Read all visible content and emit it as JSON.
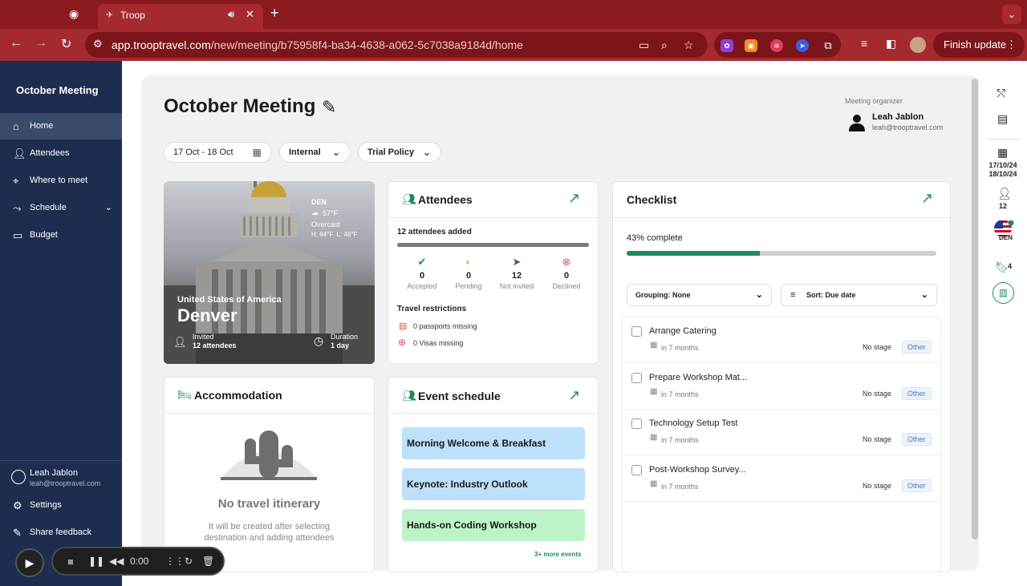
{
  "browser": {
    "tab_title": "Troop",
    "url_host": "app.trooptravel.com",
    "url_path": "/new/meeting/b75958f4-ba34-4638-a062-5c7038a9184d/home",
    "finish_update": "Finish update"
  },
  "sidebar": {
    "title": "October Meeting",
    "items": [
      {
        "label": "Home",
        "icon": "home-icon"
      },
      {
        "label": "Attendees",
        "icon": "people-icon"
      },
      {
        "label": "Where to meet",
        "icon": "pin-icon"
      },
      {
        "label": "Schedule",
        "icon": "route-icon"
      },
      {
        "label": "Budget",
        "icon": "card-icon"
      }
    ],
    "user_name": "Leah Jablon",
    "user_email": "leah@trooptravel.com",
    "settings": "Settings",
    "share_feedback": "Share feedback"
  },
  "header": {
    "title": "October Meeting",
    "organizer_label": "Meeting organizer",
    "organizer_name": "Leah Jablon",
    "organizer_email": "leah@trooptravel.com"
  },
  "filters": {
    "dates": "17 Oct - 18 Oct",
    "type": "Internal",
    "policy": "Trial Policy"
  },
  "destination": {
    "code": "DEN",
    "temp": "57°F",
    "condition": "Overcast",
    "high_low": "H: 64°F  L: 46°F",
    "country": "United States of America",
    "city": "Denver",
    "invited_label": "Invited",
    "invited_value": "12 attendees",
    "duration_label": "Duration",
    "duration_value": "1 day"
  },
  "attendees": {
    "title": "Attendees",
    "added": "12 attendees added",
    "progress": 1.0,
    "stats": [
      {
        "num": "0",
        "label": "Accepted"
      },
      {
        "num": "0",
        "label": "Pending"
      },
      {
        "num": "12",
        "label": "Not invited"
      },
      {
        "num": "0",
        "label": "Declined"
      }
    ],
    "restrictions_title": "Travel restrictions",
    "passports": "0 passports missing",
    "visas": "0 Visas missing"
  },
  "checklist": {
    "title": "Checklist",
    "complete_label": "43% complete",
    "progress": 0.43,
    "grouping": "Grouping: None",
    "sort": "Sort: Due date",
    "tasks": [
      {
        "name": "Arrange Catering",
        "due": "in 7 months",
        "stage": "No stage",
        "category": "Other"
      },
      {
        "name": "Prepare Workshop Mat...",
        "due": "in 7 months",
        "stage": "No stage",
        "category": "Other"
      },
      {
        "name": "Technology Setup Test",
        "due": "in 7 months",
        "stage": "No stage",
        "category": "Other"
      },
      {
        "name": "Post-Workshop Survey...",
        "due": "in 7 months",
        "stage": "No stage",
        "category": "Other"
      }
    ]
  },
  "accommodation": {
    "title": "Accommodation",
    "empty_title": "No travel itinerary",
    "empty_desc_1": "It will be created after selecting",
    "empty_desc_2": "destination and adding attendees"
  },
  "schedule": {
    "title": "Event schedule",
    "events": [
      {
        "name": "Morning Welcome & Breakfast",
        "color": "#bde0fb"
      },
      {
        "name": "Keynote: Industry Outlook",
        "color": "#bde0fb"
      },
      {
        "name": "Hands-on Coding Workshop",
        "color": "#bdf3c8"
      }
    ],
    "more": "3+ more events"
  },
  "rail": {
    "date_1": "17/10/24",
    "date_2": "18/10/24",
    "attendees": "12",
    "destination": "DEN",
    "bookmarks": "4"
  },
  "recorder": {
    "time": "0:00"
  },
  "colors": {
    "sidebar": "#1e2d4f",
    "accent": "#1f8a5c",
    "browser": "#a52a2f"
  }
}
